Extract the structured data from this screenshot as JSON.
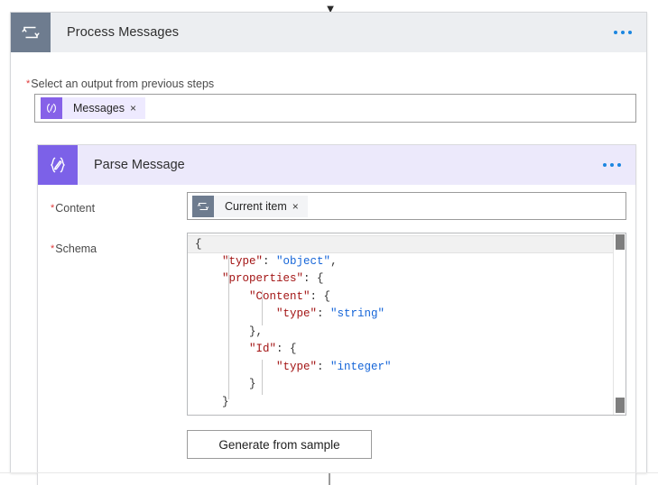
{
  "canvas": {
    "top_connector_icon": "chevron-down-icon",
    "bottom_connector": "vertical-line"
  },
  "outer_card": {
    "icon": "loop-repeat-icon",
    "title": "Process Messages",
    "menu_label": "···",
    "accent_color": "#6e7c8f",
    "header_bg": "#eceef1",
    "select_output": {
      "required": true,
      "star": "*",
      "label": "Select an output from previous steps",
      "token": {
        "icon": "expression-code-icon",
        "label": "Messages",
        "remove": "×",
        "icon_bg": "#8661e8",
        "chip_bg": "#eeeaff"
      }
    }
  },
  "inner_card": {
    "icon": "json-braces-pencil-icon",
    "title": "Parse Message",
    "menu_label": "···",
    "accent_color": "#7c61e8",
    "header_bg": "#ece9fb",
    "content_field": {
      "required": true,
      "star": "*",
      "label": "Content",
      "token": {
        "icon": "loop-repeat-icon",
        "label": "Current item",
        "remove": "×",
        "icon_bg": "#6e7c8f",
        "chip_bg": "#f3f4f6"
      }
    },
    "schema_field": {
      "required": true,
      "star": "*",
      "label": "Schema",
      "code_lines": [
        {
          "selected": true,
          "indent": 0,
          "segments": [
            {
              "t": "{",
              "c": "p"
            }
          ]
        },
        {
          "selected": false,
          "indent": 0,
          "segments": [
            {
              "t": "    ",
              "c": "p"
            },
            {
              "t": "\"type\"",
              "c": "k"
            },
            {
              "t": ": ",
              "c": "p"
            },
            {
              "t": "\"object\"",
              "c": "s"
            },
            {
              "t": ",",
              "c": "p"
            }
          ]
        },
        {
          "selected": false,
          "indent": 0,
          "segments": [
            {
              "t": "    ",
              "c": "p"
            },
            {
              "t": "\"properties\"",
              "c": "k"
            },
            {
              "t": ": {",
              "c": "p"
            }
          ]
        },
        {
          "selected": false,
          "indent": 0,
          "segments": [
            {
              "t": "        ",
              "c": "p"
            },
            {
              "t": "\"Content\"",
              "c": "k"
            },
            {
              "t": ": {",
              "c": "p"
            }
          ]
        },
        {
          "selected": false,
          "indent": 0,
          "segments": [
            {
              "t": "            ",
              "c": "p"
            },
            {
              "t": "\"type\"",
              "c": "k"
            },
            {
              "t": ": ",
              "c": "p"
            },
            {
              "t": "\"string\"",
              "c": "s"
            }
          ]
        },
        {
          "selected": false,
          "indent": 0,
          "segments": [
            {
              "t": "        },",
              "c": "p"
            }
          ]
        },
        {
          "selected": false,
          "indent": 0,
          "segments": [
            {
              "t": "        ",
              "c": "p"
            },
            {
              "t": "\"Id\"",
              "c": "k"
            },
            {
              "t": ": {",
              "c": "p"
            }
          ]
        },
        {
          "selected": false,
          "indent": 0,
          "segments": [
            {
              "t": "            ",
              "c": "p"
            },
            {
              "t": "\"type\"",
              "c": "k"
            },
            {
              "t": ": ",
              "c": "p"
            },
            {
              "t": "\"integer\"",
              "c": "s"
            }
          ]
        },
        {
          "selected": false,
          "indent": 0,
          "segments": [
            {
              "t": "        }",
              "c": "p"
            }
          ]
        },
        {
          "selected": false,
          "indent": 0,
          "segments": [
            {
              "t": "    }",
              "c": "p"
            }
          ]
        }
      ],
      "scrollbar": {
        "thumb_top": true,
        "thumb_bottom": true
      }
    },
    "generate_button": "Generate from sample"
  },
  "colors": {
    "required_star": "#e03b3b",
    "json_key": "#a31515",
    "json_string": "#1565d8",
    "menu_dot": "#1b86e0"
  }
}
